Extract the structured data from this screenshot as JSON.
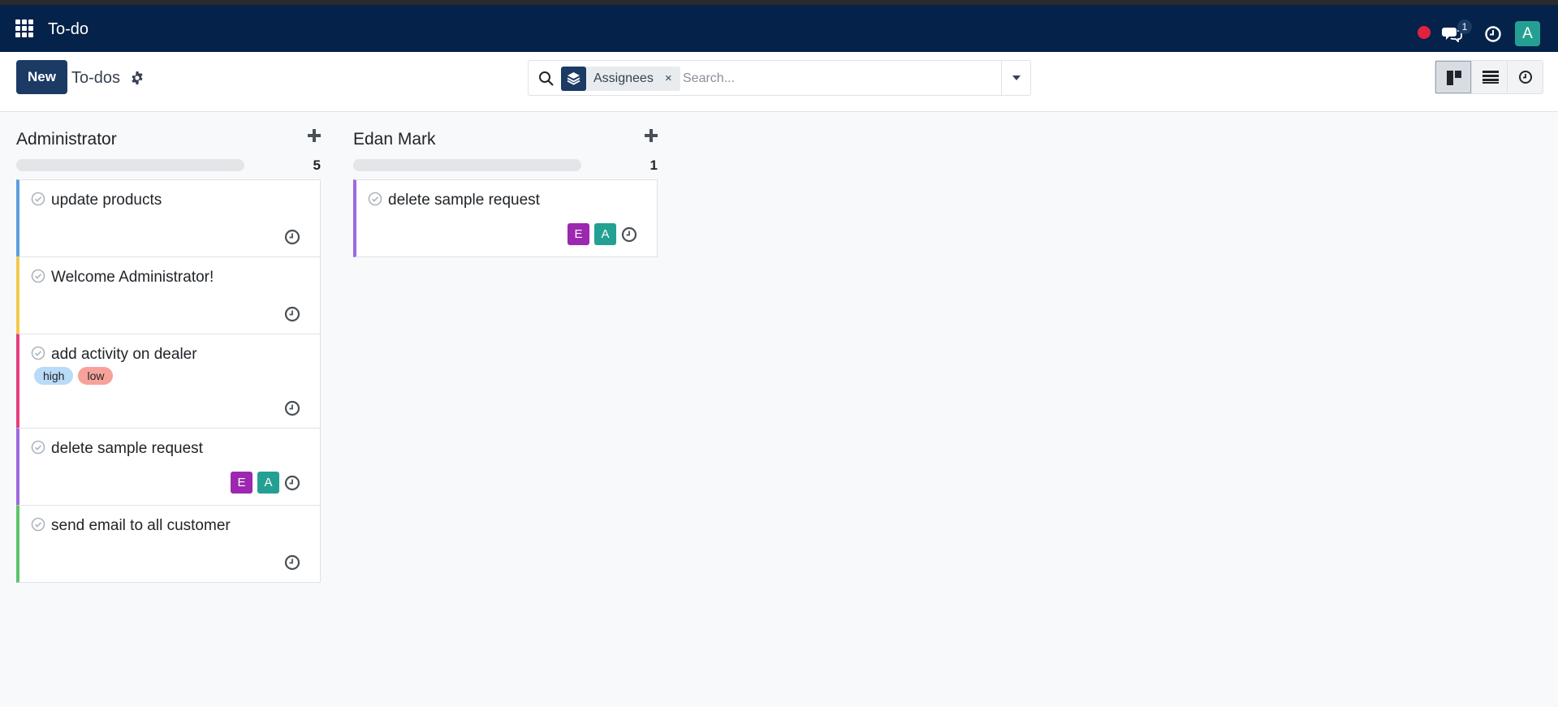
{
  "navbar": {
    "app_title": "To-do",
    "chat_badge": "1",
    "user_initial": "A",
    "colors": {
      "background": "#05224a",
      "record_dot": "#e0233c",
      "avatar": "#24a092"
    }
  },
  "control_panel": {
    "new_button_label": "New",
    "breadcrumb_title": "To-dos",
    "search": {
      "facet_label": "Assignees",
      "facet_remove": "×",
      "placeholder": "Search..."
    },
    "views": [
      "kanban",
      "list",
      "activity"
    ],
    "active_view": "kanban"
  },
  "columns": [
    {
      "title": "Administrator",
      "count": "5",
      "cards": [
        {
          "title": "update products",
          "color": "#5aa0dc",
          "tags": [],
          "assignees": []
        },
        {
          "title": "Welcome Administrator!",
          "color": "#f2c94c",
          "tags": [],
          "assignees": []
        },
        {
          "title": "add activity on dealer",
          "color": "#e63e7f",
          "tags": [
            {
              "label": "high",
              "color": "#b9dbf8"
            },
            {
              "label": "low",
              "color": "#f6a29b"
            }
          ],
          "assignees": []
        },
        {
          "title": "delete sample request",
          "color": "#9c6ade",
          "tags": [],
          "assignees": [
            {
              "initial": "E",
              "color": "#9c27b0"
            },
            {
              "initial": "A",
              "color": "#24a092"
            }
          ]
        },
        {
          "title": "send email to all customer",
          "color": "#5cc46b",
          "tags": [],
          "assignees": []
        }
      ]
    },
    {
      "title": "Edan Mark",
      "count": "1",
      "cards": [
        {
          "title": "delete sample request",
          "color": "#9c6ade",
          "tags": [],
          "assignees": [
            {
              "initial": "E",
              "color": "#9c27b0"
            },
            {
              "initial": "A",
              "color": "#24a092"
            }
          ]
        }
      ]
    }
  ]
}
